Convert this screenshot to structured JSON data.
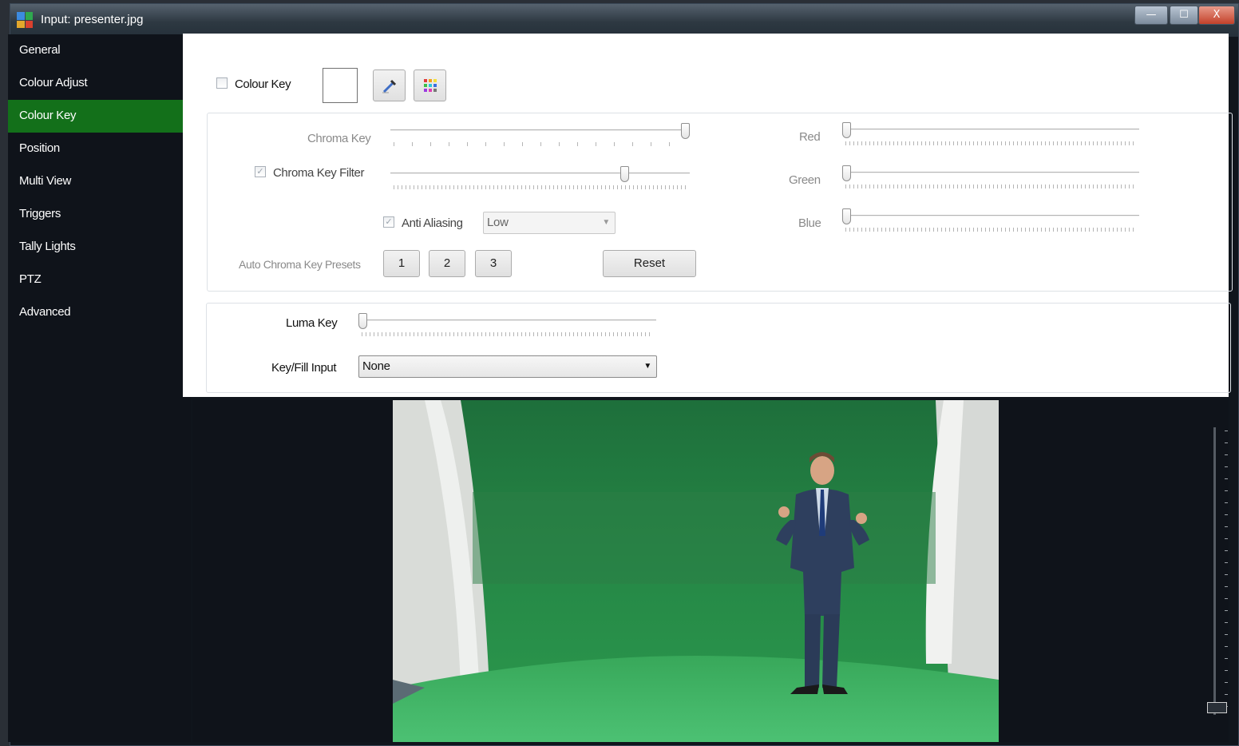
{
  "window": {
    "title": "Input: presenter.jpg",
    "minimize": "—",
    "maximize": "☐",
    "close": "X"
  },
  "sidebar": {
    "items": [
      {
        "label": "General"
      },
      {
        "label": "Colour Adjust"
      },
      {
        "label": "Colour Key",
        "active": true
      },
      {
        "label": "Position"
      },
      {
        "label": "Multi View"
      },
      {
        "label": "Triggers"
      },
      {
        "label": "Tally Lights"
      },
      {
        "label": "PTZ"
      },
      {
        "label": "Advanced"
      }
    ]
  },
  "colour_key": {
    "enable_label": "Colour Key",
    "enabled": false,
    "swatch_color": "#ffffff",
    "chroma_key": {
      "label": "Chroma Key",
      "value": 1.0
    },
    "chroma_key_filter": {
      "label": "Chroma Key Filter",
      "checked": true,
      "value": 0.79
    },
    "anti_aliasing": {
      "label": "Anti Aliasing",
      "checked": true,
      "value": "Low"
    },
    "auto_presets": {
      "label": "Auto Chroma Key Presets",
      "buttons": [
        "1",
        "2",
        "3"
      ]
    },
    "reset_label": "Reset",
    "red": {
      "label": "Red",
      "value": 0.0
    },
    "green": {
      "label": "Green",
      "value": 0.0
    },
    "blue": {
      "label": "Blue",
      "value": 0.0
    }
  },
  "luma_key": {
    "label": "Luma Key",
    "value": 0.0
  },
  "key_fill": {
    "label": "Key/Fill Input",
    "value": "None"
  },
  "preview": {
    "zoom_level": 0.0
  },
  "colors": {
    "active_nav": "#13701a",
    "background": "#0f131a",
    "green_screen": "#2a8a48"
  },
  "icons": [
    "eyedropper-icon",
    "palette-icon",
    "app-grid-icon",
    "dropdown-arrow-icon"
  ]
}
